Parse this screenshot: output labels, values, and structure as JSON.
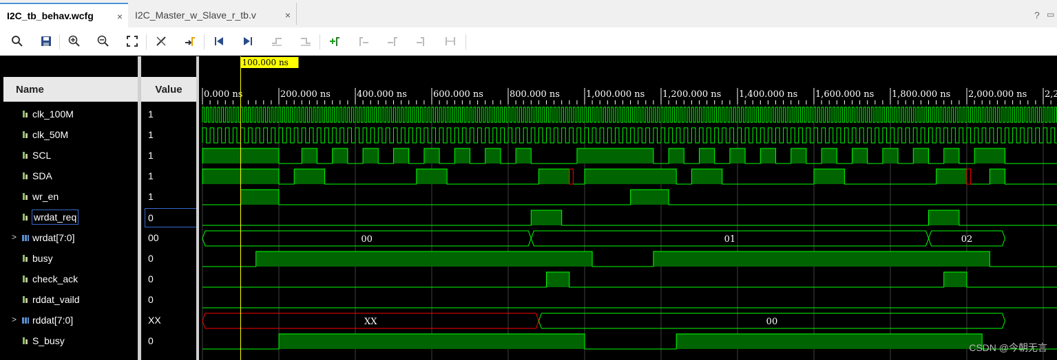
{
  "tabs": [
    {
      "label": "I2C_tb_behav.wcfg",
      "active": true
    },
    {
      "label": "I2C_Master_w_Slave_r_tb.v",
      "active": false
    }
  ],
  "window_controls": {
    "help": "?",
    "restore": "▭"
  },
  "toolbar": {
    "buttons": [
      "search-icon",
      "save-icon",
      "zoom-in-icon",
      "zoom-out-icon",
      "zoom-fit-icon",
      "cursor-remove-icon",
      "go-to-cursor-icon",
      "go-to-start-icon",
      "go-to-end-icon",
      "previous-transition-icon",
      "next-transition-icon",
      "add-marker-icon",
      "previous-marker-icon",
      "next-marker-icon",
      "swap-cursors-icon",
      "snap-to-transition-icon"
    ]
  },
  "columns": {
    "name": "Name",
    "value": "Value"
  },
  "cursor": {
    "label": "100.000 ns",
    "time_ns": 100
  },
  "time_axis": {
    "ticks": [
      "0.000 ns",
      "200.000 ns",
      "400.000 ns",
      "600.000 ns",
      "800.000 ns",
      "1,000.000 ns",
      "1,200.000 ns",
      "1,400.000 ns",
      "1,600.000 ns",
      "1,800.000 ns",
      "2,000.000 ns",
      "2,2"
    ],
    "start_ns": 0,
    "ns_per_major": 200
  },
  "signals": [
    {
      "name": "clk_100M",
      "value": "1",
      "type": "bit"
    },
    {
      "name": "clk_50M",
      "value": "1",
      "type": "bit"
    },
    {
      "name": "SCL",
      "value": "1",
      "type": "bit"
    },
    {
      "name": "SDA",
      "value": "1",
      "type": "bit"
    },
    {
      "name": "wr_en",
      "value": "1",
      "type": "bit"
    },
    {
      "name": "wrdat_req",
      "value": "0",
      "type": "bit",
      "selected": true
    },
    {
      "name": "wrdat[7:0]",
      "value": "00",
      "type": "bus"
    },
    {
      "name": "busy",
      "value": "0",
      "type": "bit"
    },
    {
      "name": "check_ack",
      "value": "0",
      "type": "bit"
    },
    {
      "name": "rddat_vaild",
      "value": "0",
      "type": "bit"
    },
    {
      "name": "rddat[7:0]",
      "value": "XX",
      "type": "bus"
    },
    {
      "name": "S_busy",
      "value": "0",
      "type": "bit"
    }
  ],
  "waveforms": {
    "SCL_high_ns": [
      [
        0,
        200
      ],
      [
        260,
        300
      ],
      [
        340,
        380
      ],
      [
        420,
        460
      ],
      [
        500,
        540
      ],
      [
        580,
        620
      ],
      [
        660,
        700
      ],
      [
        740,
        780
      ],
      [
        820,
        860
      ],
      [
        980,
        1180
      ],
      [
        1220,
        1260
      ],
      [
        1300,
        1340
      ],
      [
        1380,
        1420
      ],
      [
        1460,
        1500
      ],
      [
        1540,
        1580
      ],
      [
        1620,
        1660
      ],
      [
        1700,
        1740
      ],
      [
        1780,
        1820
      ],
      [
        1860,
        1900
      ],
      [
        1940,
        1980
      ],
      [
        2020,
        2100
      ]
    ],
    "SDA_high_ns": [
      [
        0,
        200
      ],
      [
        240,
        320
      ],
      [
        560,
        640
      ],
      [
        880,
        960
      ],
      [
        1000,
        1240
      ],
      [
        1280,
        1360
      ],
      [
        1600,
        1680
      ],
      [
        1920,
        2000
      ],
      [
        2060,
        2100
      ]
    ],
    "SDA_x_ns": [
      [
        960,
        970
      ],
      [
        2000,
        2010
      ]
    ],
    "wr_en_high_ns": [
      [
        100,
        200
      ],
      [
        1120,
        1220
      ]
    ],
    "wrdat_req_high_ns": [
      [
        860,
        940
      ],
      [
        1900,
        1980
      ]
    ],
    "wrdat_segments": [
      {
        "from": 0,
        "to": 860,
        "label": "00"
      },
      {
        "from": 860,
        "to": 1900,
        "label": "01"
      },
      {
        "from": 1900,
        "to": 2100,
        "label": "02"
      }
    ],
    "busy_high_ns": [
      [
        140,
        1020
      ],
      [
        1180,
        2060
      ]
    ],
    "check_ack_high_ns": [
      [
        900,
        960
      ],
      [
        1940,
        2000
      ]
    ],
    "rddat_vaild_high_ns": [],
    "rddat_segments": [
      {
        "from": 0,
        "to": 880,
        "label": "XX",
        "unknown": true
      },
      {
        "from": 880,
        "to": 2100,
        "label": "00"
      }
    ],
    "S_busy_high_ns": [
      [
        200,
        1000
      ],
      [
        1240,
        2040
      ]
    ]
  },
  "colors": {
    "wave": "#00ff00",
    "wave_fill": "#006400",
    "unknown": "#ff0000",
    "cursor": "#ffff00",
    "grid": "#404040"
  },
  "watermark": "CSDN @今朝无言"
}
